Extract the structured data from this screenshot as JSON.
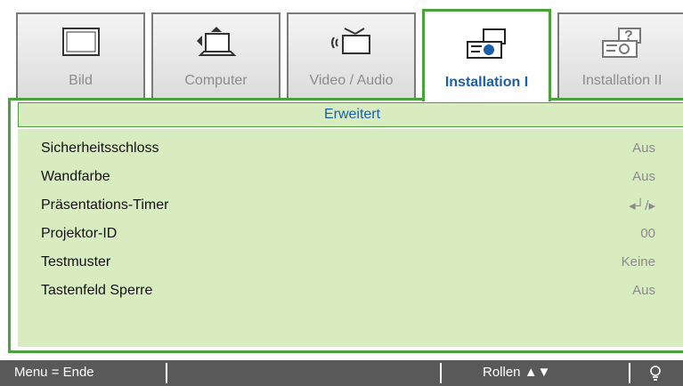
{
  "tabs": [
    {
      "label": "Bild",
      "icon": "monitor-icon",
      "active": false
    },
    {
      "label": "Computer",
      "icon": "computer-icon",
      "active": false
    },
    {
      "label": "Video / Audio",
      "icon": "video-audio-icon",
      "active": false
    },
    {
      "label": "Installation I",
      "icon": "projector-icon",
      "active": true
    },
    {
      "label": "Installation II",
      "icon": "projector-help-icon",
      "active": false
    }
  ],
  "section_title": "Erweitert",
  "items": [
    {
      "name": "Sicherheitsschloss",
      "value": "Aus"
    },
    {
      "name": "Wandfarbe",
      "value": "Aus"
    },
    {
      "name": "Präsentations-Timer",
      "value": "◂┘/▸"
    },
    {
      "name": "Projektor-ID",
      "value": "00"
    },
    {
      "name": "Testmuster",
      "value": "Keine"
    },
    {
      "name": "Tastenfeld Sperre",
      "value": "Aus"
    }
  ],
  "footer": {
    "menu_hint": "Menu = Ende",
    "scroll_hint": "Rollen ▲▼",
    "info_icon": "lightbulb-icon"
  },
  "colors": {
    "accent_green": "#4aa33a",
    "panel_green": "#d8ecc0",
    "active_blue": "#1a5fa8",
    "footer_gray": "#595959"
  }
}
